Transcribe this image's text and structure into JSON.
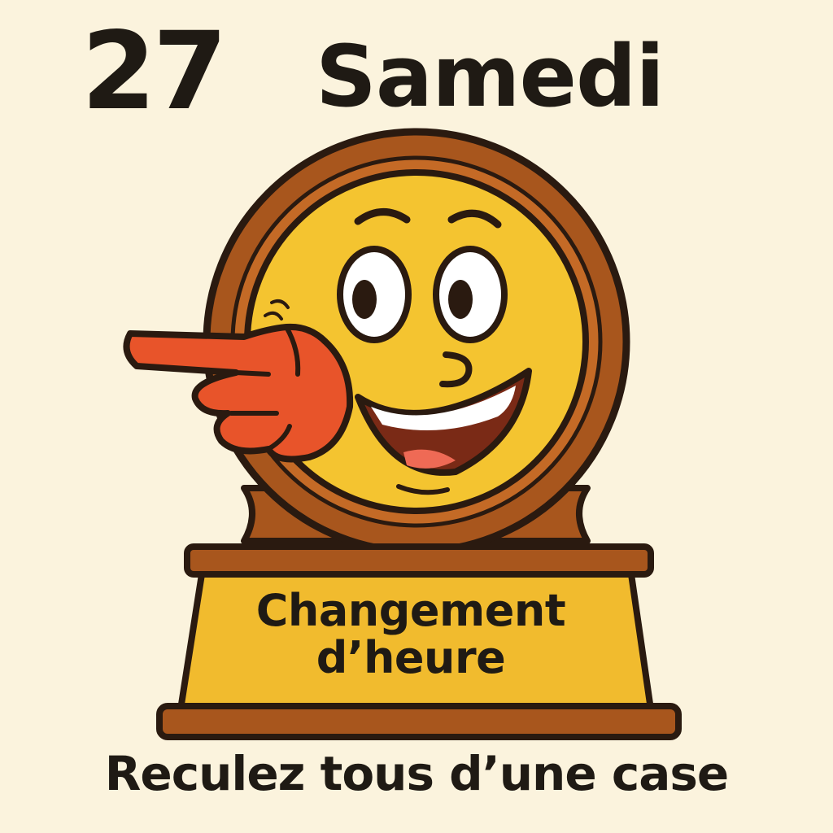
{
  "header": {
    "day_number": "27",
    "day_name": "Samedi"
  },
  "plaque": {
    "line1": "Changement",
    "line2": "d’heure"
  },
  "footer": {
    "instruction": "Reculez tous d’une case"
  },
  "icons": {
    "clock": "smiling-clock-icon",
    "hand": "pointing-hand-icon"
  },
  "colors": {
    "background": "#fbf3dd",
    "clock_face": "#f4c430",
    "clock_frame": "#a8561d",
    "hand": "#e8542a",
    "plaque": "#f1bb2e",
    "outline": "#2a1a10"
  }
}
